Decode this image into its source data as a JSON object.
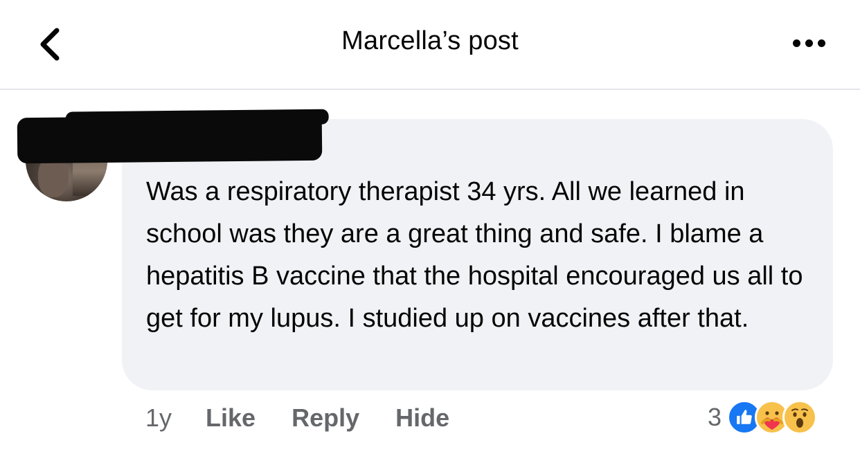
{
  "header": {
    "title": "Marcella’s post",
    "back_icon": "chevron-left-icon",
    "more_icon": "more-dots-icon"
  },
  "comment": {
    "author": "",
    "text": "Was a respiratory therapist 34 yrs. All we learned in school was they are a great thing and safe. I blame a hepatitis B vaccine that the hospital encouraged us all to get for my lupus. I studied up on vaccines after that.",
    "age": "1y",
    "like_label": "Like",
    "reply_label": "Reply",
    "hide_label": "Hide",
    "reaction_count": "3",
    "reactions": [
      "like-reaction-icon",
      "care-reaction-icon",
      "wow-reaction-icon"
    ]
  },
  "colors": {
    "bubble": "#f0f2f5",
    "secondary_text": "#65676b",
    "like_blue": "#1877f2",
    "reaction_yellow": "#f7c14b"
  }
}
